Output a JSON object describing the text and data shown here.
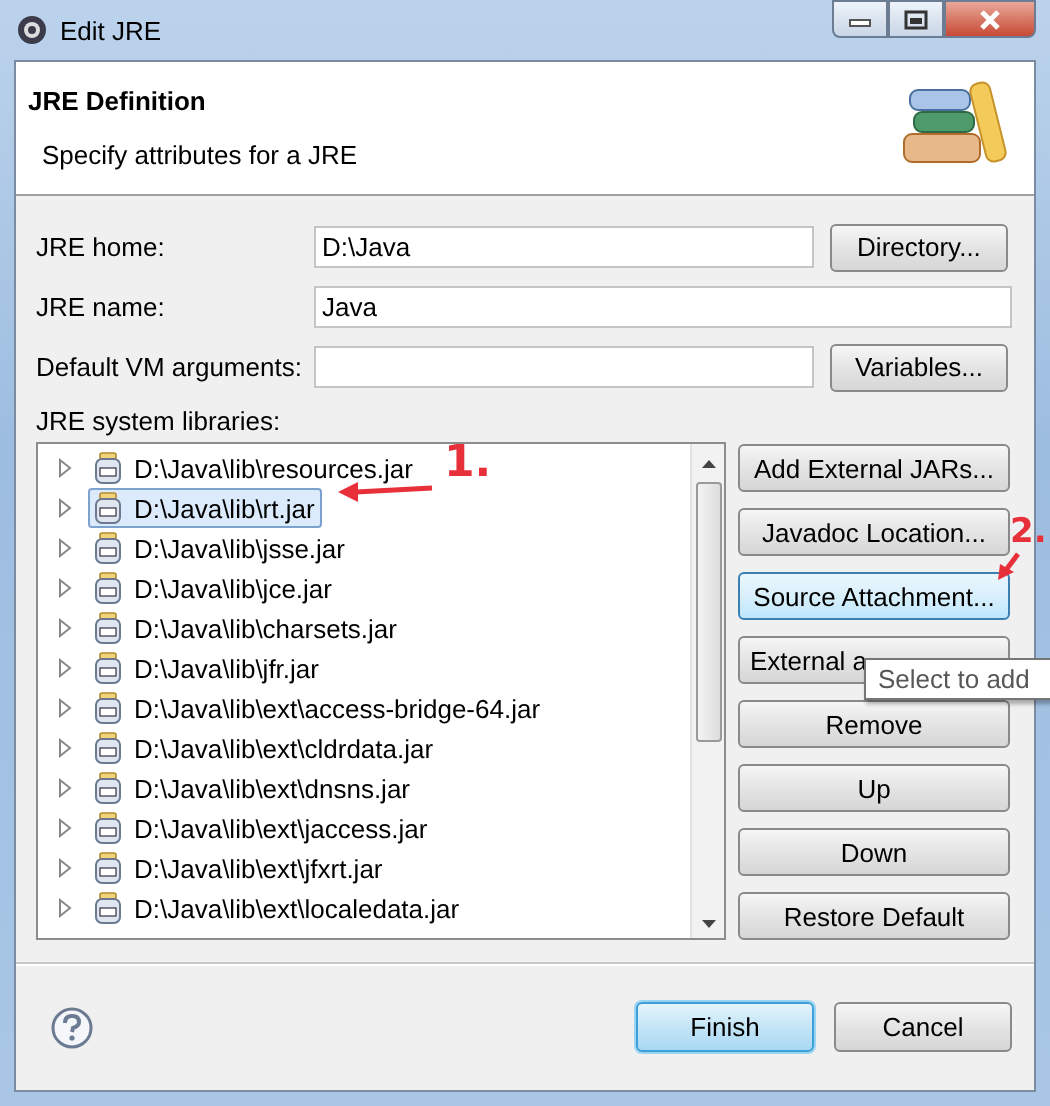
{
  "window": {
    "title": "Edit JRE"
  },
  "header": {
    "title": "JRE Definition",
    "description": "Specify attributes for a JRE"
  },
  "fields": [
    {
      "label": "JRE home:",
      "value": "D:\\Java",
      "button": "Directory..."
    },
    {
      "label": "JRE name:",
      "value": "Java"
    },
    {
      "label": "Default VM arguments:",
      "button": "Variables..."
    }
  ],
  "libraries": {
    "label": "JRE system libraries:",
    "items": [
      {
        "path": "D:\\Java\\lib\\resources.jar",
        "selected": false,
        "expanded": false
      },
      {
        "path": "D:\\Java\\lib\\rt.jar",
        "selected": true,
        "expanded": false
      },
      {
        "path": "D:\\Java\\lib\\jsse.jar",
        "selected": false,
        "expanded": false
      },
      {
        "path": "D:\\Java\\lib\\jce.jar",
        "selected": false,
        "expanded": false
      },
      {
        "path": "D:\\Java\\lib\\charsets.jar",
        "selected": false,
        "expanded": false
      },
      {
        "path": "D:\\Java\\lib\\jfr.jar",
        "selected": false,
        "expanded": false
      },
      {
        "path": "D:\\Java\\lib\\ext\\access-bridge-64.jar",
        "selected": false,
        "expanded": false
      },
      {
        "path": "D:\\Java\\lib\\ext\\cldrdata.jar",
        "selected": false,
        "expanded": false
      },
      {
        "path": "D:\\Java\\lib\\ext\\dnsns.jar",
        "selected": false,
        "expanded": false
      },
      {
        "path": "D:\\Java\\lib\\ext\\jaccess.jar",
        "selected": false,
        "expanded": false
      },
      {
        "path": "D:\\Java\\lib\\ext\\jfxrt.jar",
        "selected": false,
        "expanded": false
      },
      {
        "path": "D:\\Java\\lib\\ext\\localedata.jar",
        "selected": false,
        "expanded": false
      }
    ]
  },
  "side_buttons": [
    {
      "label": "Add External JARs...",
      "hovered": false
    },
    {
      "label": "Javadoc Location...",
      "hovered": false
    },
    {
      "label": "Source Attachment...",
      "hovered": true
    },
    {
      "label": "External a",
      "hovered": false
    },
    {
      "label": "Remove",
      "hovered": false
    },
    {
      "label": "Up",
      "hovered": false
    },
    {
      "label": "Down",
      "hovered": false
    },
    {
      "label": "Restore Default",
      "hovered": false
    }
  ],
  "tooltip": "Select to add",
  "footer_buttons": [
    {
      "label": "Finish",
      "default": true
    },
    {
      "label": "Cancel",
      "default": false
    }
  ],
  "annotations": [
    "1.",
    "2."
  ]
}
